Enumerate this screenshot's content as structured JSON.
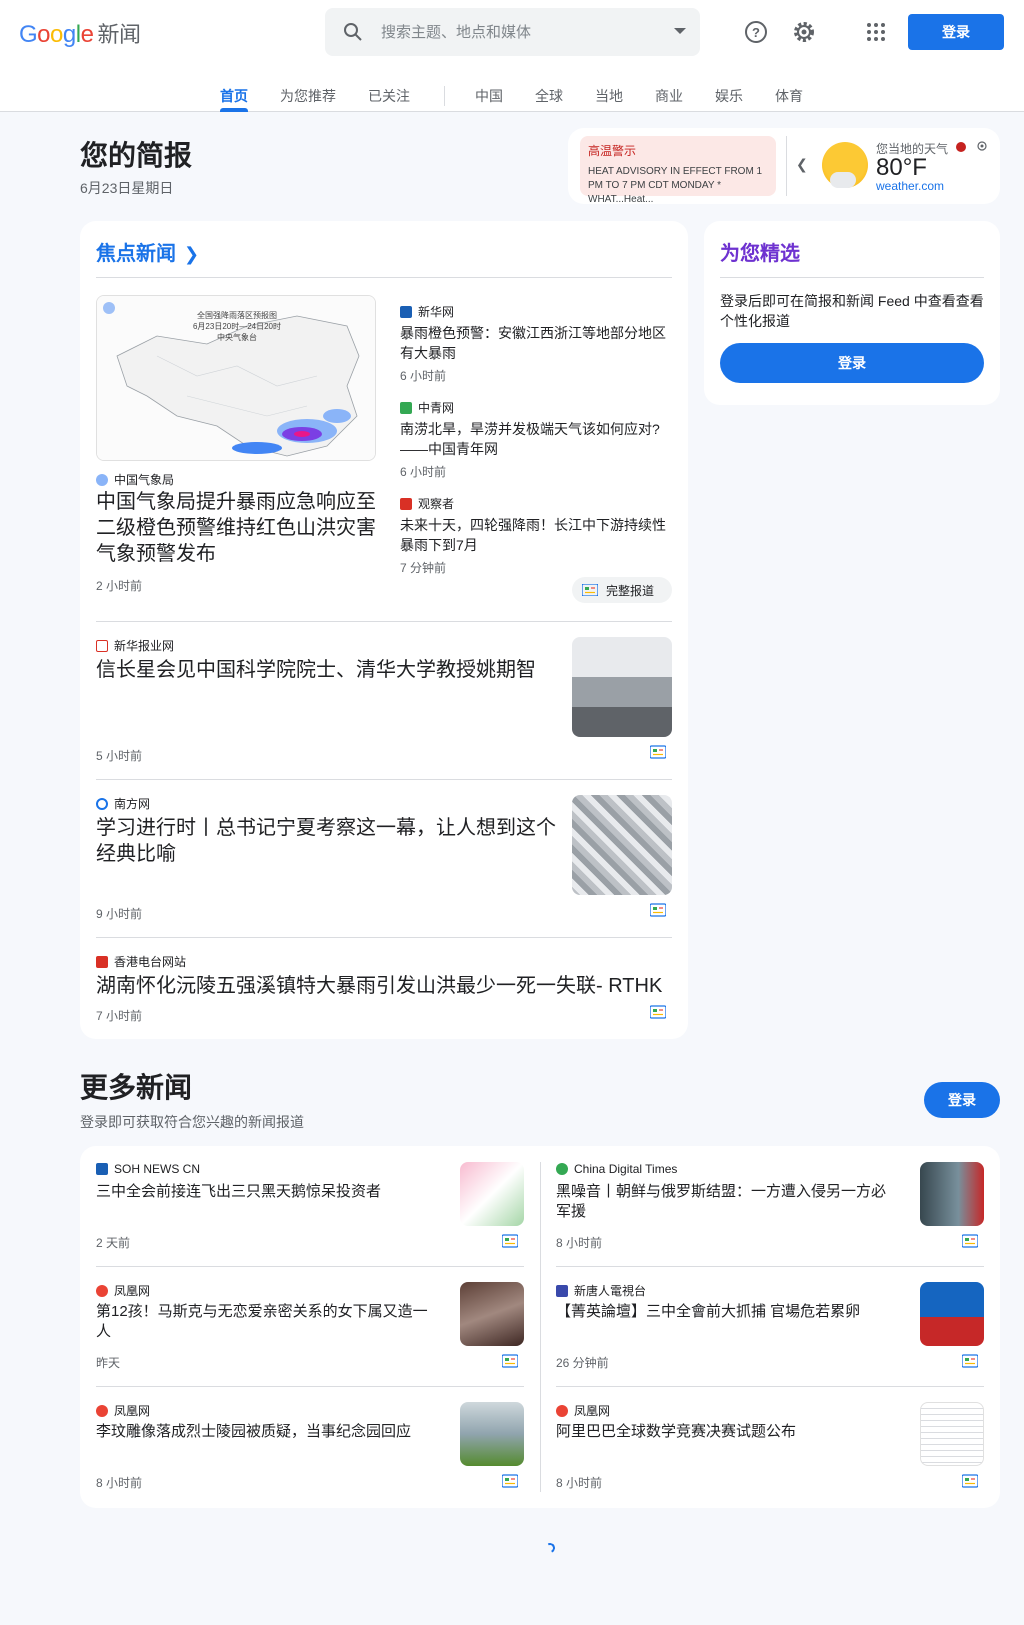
{
  "header": {
    "logo": {
      "g1": "G",
      "g2": "o",
      "g3": "o",
      "g4": "g",
      "g5": "l",
      "g6": "e",
      "news": "新闻"
    },
    "search_placeholder": "搜索主题、地点和媒体",
    "signin_label": "登录",
    "icons": [
      "search-icon",
      "help-icon",
      "settings-icon",
      "apps-icon"
    ]
  },
  "nav": {
    "tabs": [
      "首页",
      "为您推荐",
      "已关注",
      "中国",
      "全球",
      "当地",
      "商业",
      "娱乐",
      "体育"
    ],
    "active": "首页"
  },
  "briefing": {
    "title": "您的简报",
    "date": "6月23日星期日"
  },
  "weather": {
    "alert_title": "高温警示",
    "alert_body": "HEAT ADVISORY IN EFFECT FROM 1 PM TO 7 PM CDT MONDAY * WHAT...Heat...",
    "location_label": "您当地的天气",
    "temperature": "80°F",
    "source": "weather.com"
  },
  "top_stories": {
    "heading": "焦点新闻",
    "lead": {
      "source": "中国气象局",
      "title": "中国气象局提升暴雨应急响应至二级橙色预警维持红色山洪灾害气象预警发布",
      "time": "2 小时前",
      "map_texts": {
        "t1": "全国强降雨落区预报图",
        "t2": "6月23日20时—24日20时",
        "t3": "中央气象台"
      }
    },
    "side": [
      {
        "source": "新华网",
        "title": "暴雨橙色预警：安徽江西浙江等地部分地区有大暴雨",
        "time": "6 小时前"
      },
      {
        "source": "中青网",
        "title": "南涝北旱，旱涝并发极端天气该如何应对?——中国青年网",
        "time": "6 小时前"
      },
      {
        "source": "观察者",
        "title": "未来十天，四轮强降雨！长江中下游持续性暴雨下到7月",
        "time": "7 分钟前"
      }
    ],
    "full_coverage": "完整报道",
    "stories": [
      {
        "source": "新华报业网",
        "title": "信长星会见中国科学院院士、清华大学教授姚期智",
        "time": "5 小时前"
      },
      {
        "source": "南方网",
        "title": "学习进行时丨总书记宁夏考察这一幕，让人想到这个经典比喻",
        "time": "9 小时前"
      },
      {
        "source": "香港电台网站",
        "title": "湖南怀化沅陵五强溪镇特大暴雨引发山洪最少一死一失联- RTHK",
        "time": "7 小时前"
      }
    ]
  },
  "for_you": {
    "heading": "为您精选",
    "body": "登录后即可在简报和新闻 Feed 中查看查看个性化报道",
    "button": "登录"
  },
  "more_news": {
    "title": "更多新闻",
    "subtitle": "登录即可获取符合您兴趣的新闻报道",
    "button": "登录",
    "left": [
      {
        "source": "SOH NEWS CN",
        "title": "三中全会前接连飞出三只黑天鹅惊呆投资者",
        "time": "2 天前"
      },
      {
        "source": "凤凰网",
        "title": "第12孩！马斯克与无恋爱亲密关系的女下属又造一人",
        "time": "昨天"
      },
      {
        "source": "凤凰网",
        "title": "李玟雕像落成烈士陵园被质疑，当事纪念园回应",
        "time": "8 小时前"
      }
    ],
    "right": [
      {
        "source": "China Digital Times",
        "title": "黑噪音丨朝鲜与俄罗斯结盟：一方遭入侵另一方必军援",
        "time": "8 小时前"
      },
      {
        "source": "新唐人電視台",
        "title": "【菁英論壇】三中全會前大抓捕 官場危若累卵",
        "time": "26 分钟前"
      },
      {
        "source": "凤凰网",
        "title": "阿里巴巴全球数学竞赛决赛试题公布",
        "time": "8 小时前"
      }
    ]
  },
  "colors": {
    "accent": "#1a73e8",
    "foryou": "#6e32d0",
    "alert_bg": "#fce8e6",
    "alert_text": "#c5221f"
  }
}
